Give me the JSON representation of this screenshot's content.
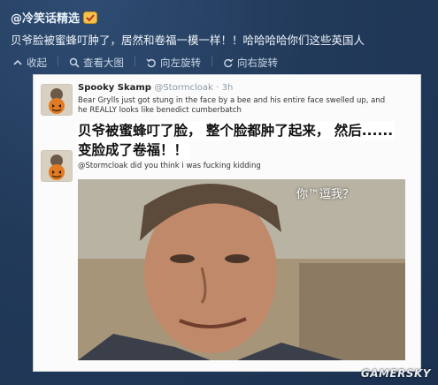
{
  "post": {
    "author": "@冷笑话精选",
    "text": "贝爷脸被蜜蜂叮肿了，居然和卷福一模一样！！哈哈哈哈你们这些英国人"
  },
  "toolbar": {
    "collapse": "收起",
    "view_large": "查看大图",
    "rotate_left": "向左旋转",
    "rotate_right": "向右旋转"
  },
  "screenshot": {
    "tweet1": {
      "name": "Spooky Skamp",
      "handle": "@Stormcloak",
      "time": "· 3h",
      "text_line1": "Bear Grylls just got stung in the face by a bee and his entire face swelled up, and",
      "text_line2": "he REALLY looks like benedict cumberbatch"
    },
    "overlay_line1": "贝爷被蜜蜂叮了脸， 整个脸都肿了起来， 然后......",
    "overlay_line2": "变脸成了卷福！！",
    "tweet2": {
      "text": "@Stormcloak did you think i was fucking kidding"
    },
    "photo_caption": "你™逗我？"
  },
  "watermark": "GAMERSKY",
  "colors": {
    "page_bg": "#223a5a",
    "card_bg": "#fbfbfb"
  }
}
